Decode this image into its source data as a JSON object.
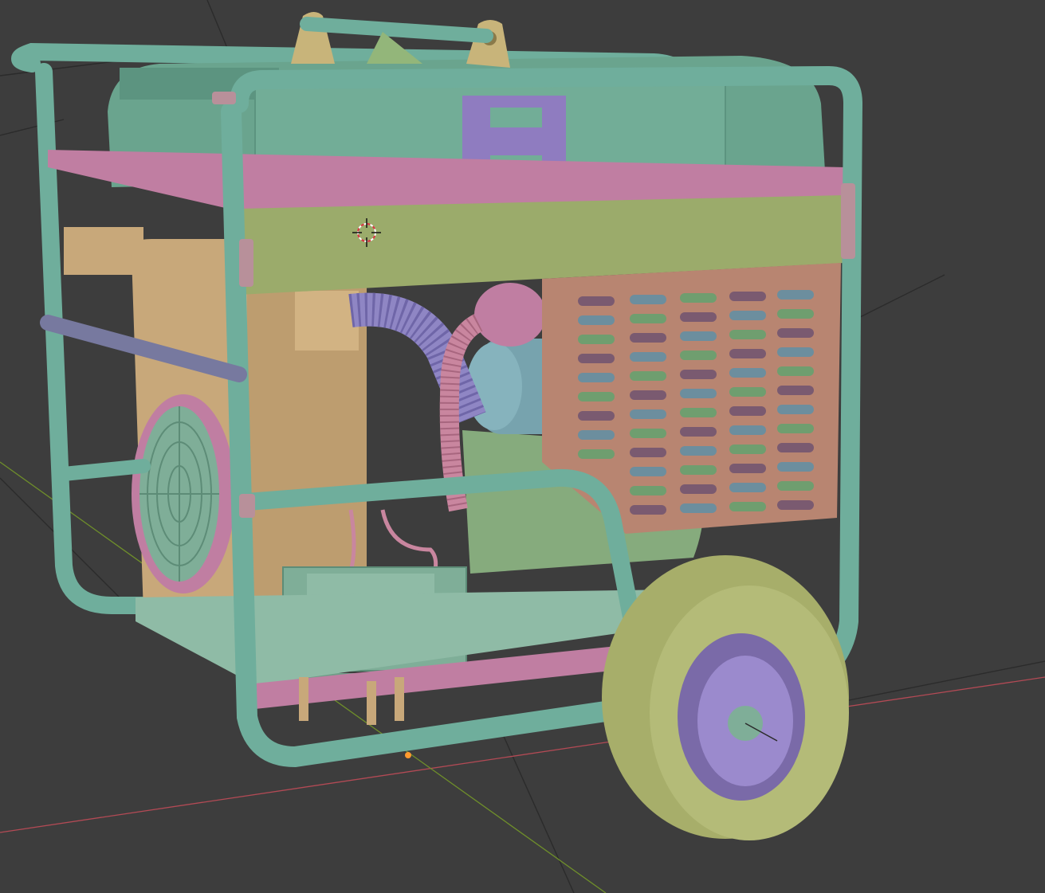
{
  "viewport": {
    "mode": "3d-viewport",
    "background": "#3d3d3d",
    "grid_color": "#2b2b2b",
    "axis_x_color": "#b34a55",
    "axis_y_color": "#6f8f2a"
  },
  "scene": {
    "object": "generator-model",
    "shading": "solid-random-color",
    "palette": {
      "frame": "#6fae9c",
      "frame_dark": "#4f8a79",
      "tank": "#6aa48e",
      "engine": "#c8a87a",
      "engine_dark": "#a88a5e",
      "panel": "#b88571",
      "plate": "#c07ea2",
      "crossbar": "#9bab6b",
      "hose": "#8f86c4",
      "hose_pink": "#c9869f",
      "battery": "#7fae98",
      "wheel": "#a7ae6a",
      "hub": "#9b8acd",
      "bracket": "#8f7cc0",
      "alt_body": "#86ab7d",
      "blue_part": "#77a3ae"
    }
  },
  "icons": {
    "cursor": "3d-cursor-icon",
    "origin": "object-origin-icon"
  }
}
